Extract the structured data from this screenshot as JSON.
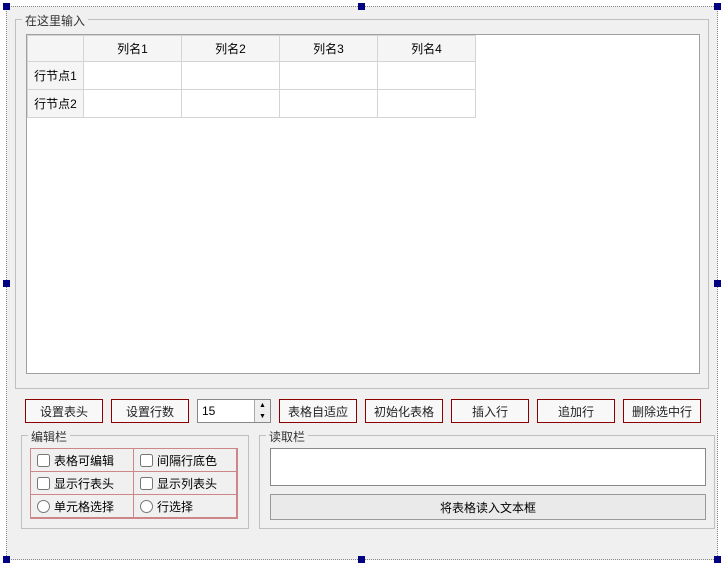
{
  "main": {
    "title": "在这里输入",
    "columns": [
      "列名1",
      "列名2",
      "列名3",
      "列名4"
    ],
    "rows": [
      "行节点1",
      "行节点2"
    ]
  },
  "toolbar": {
    "set_header": "设置表头",
    "set_rows": "设置行数",
    "row_count": "15",
    "autosize": "表格自适应",
    "init": "初始化表格",
    "insert": "插入行",
    "append": "追加行",
    "delete": "删除选中行"
  },
  "edit": {
    "title": "编辑栏",
    "editable": "表格可编辑",
    "alt_bg": "间隔行底色",
    "show_row_header": "显示行表头",
    "show_col_header": "显示列表头",
    "cell_select": "单元格选择",
    "row_select": "行选择"
  },
  "read": {
    "title": "读取栏",
    "to_textbox": "将表格读入文本框"
  }
}
